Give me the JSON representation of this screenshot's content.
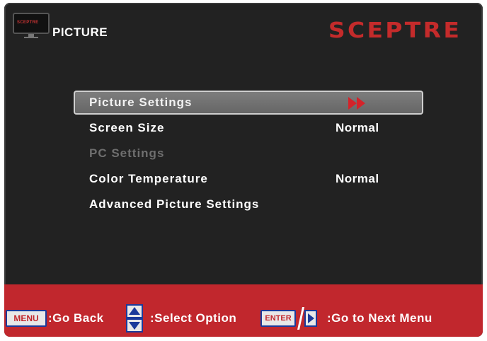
{
  "header": {
    "title": "PICTURE",
    "brand": "SCEPTRE",
    "tv_icon_label": "SCEPTRE"
  },
  "menu": {
    "items": [
      {
        "label": "Picture Settings",
        "value": "",
        "state": "selected"
      },
      {
        "label": "Screen Size",
        "value": "Normal",
        "state": "normal"
      },
      {
        "label": "PC Settings",
        "value": "",
        "state": "disabled"
      },
      {
        "label": "Color Temperature",
        "value": "Normal",
        "state": "normal"
      },
      {
        "label": "Advanced Picture Settings",
        "value": "",
        "state": "normal"
      }
    ]
  },
  "footer": {
    "menu_key": "MENU",
    "go_back": ":Go Back",
    "select_option": ":Select Option",
    "enter_key": "ENTER",
    "next_menu": ":Go to Next Menu"
  },
  "colors": {
    "background": "#222222",
    "accent_red": "#c1272d",
    "selected_bg": "#747474"
  },
  "icons": [
    "tv-icon",
    "double-arrow-right-icon",
    "up-down-icon",
    "right-arrow-icon"
  ]
}
